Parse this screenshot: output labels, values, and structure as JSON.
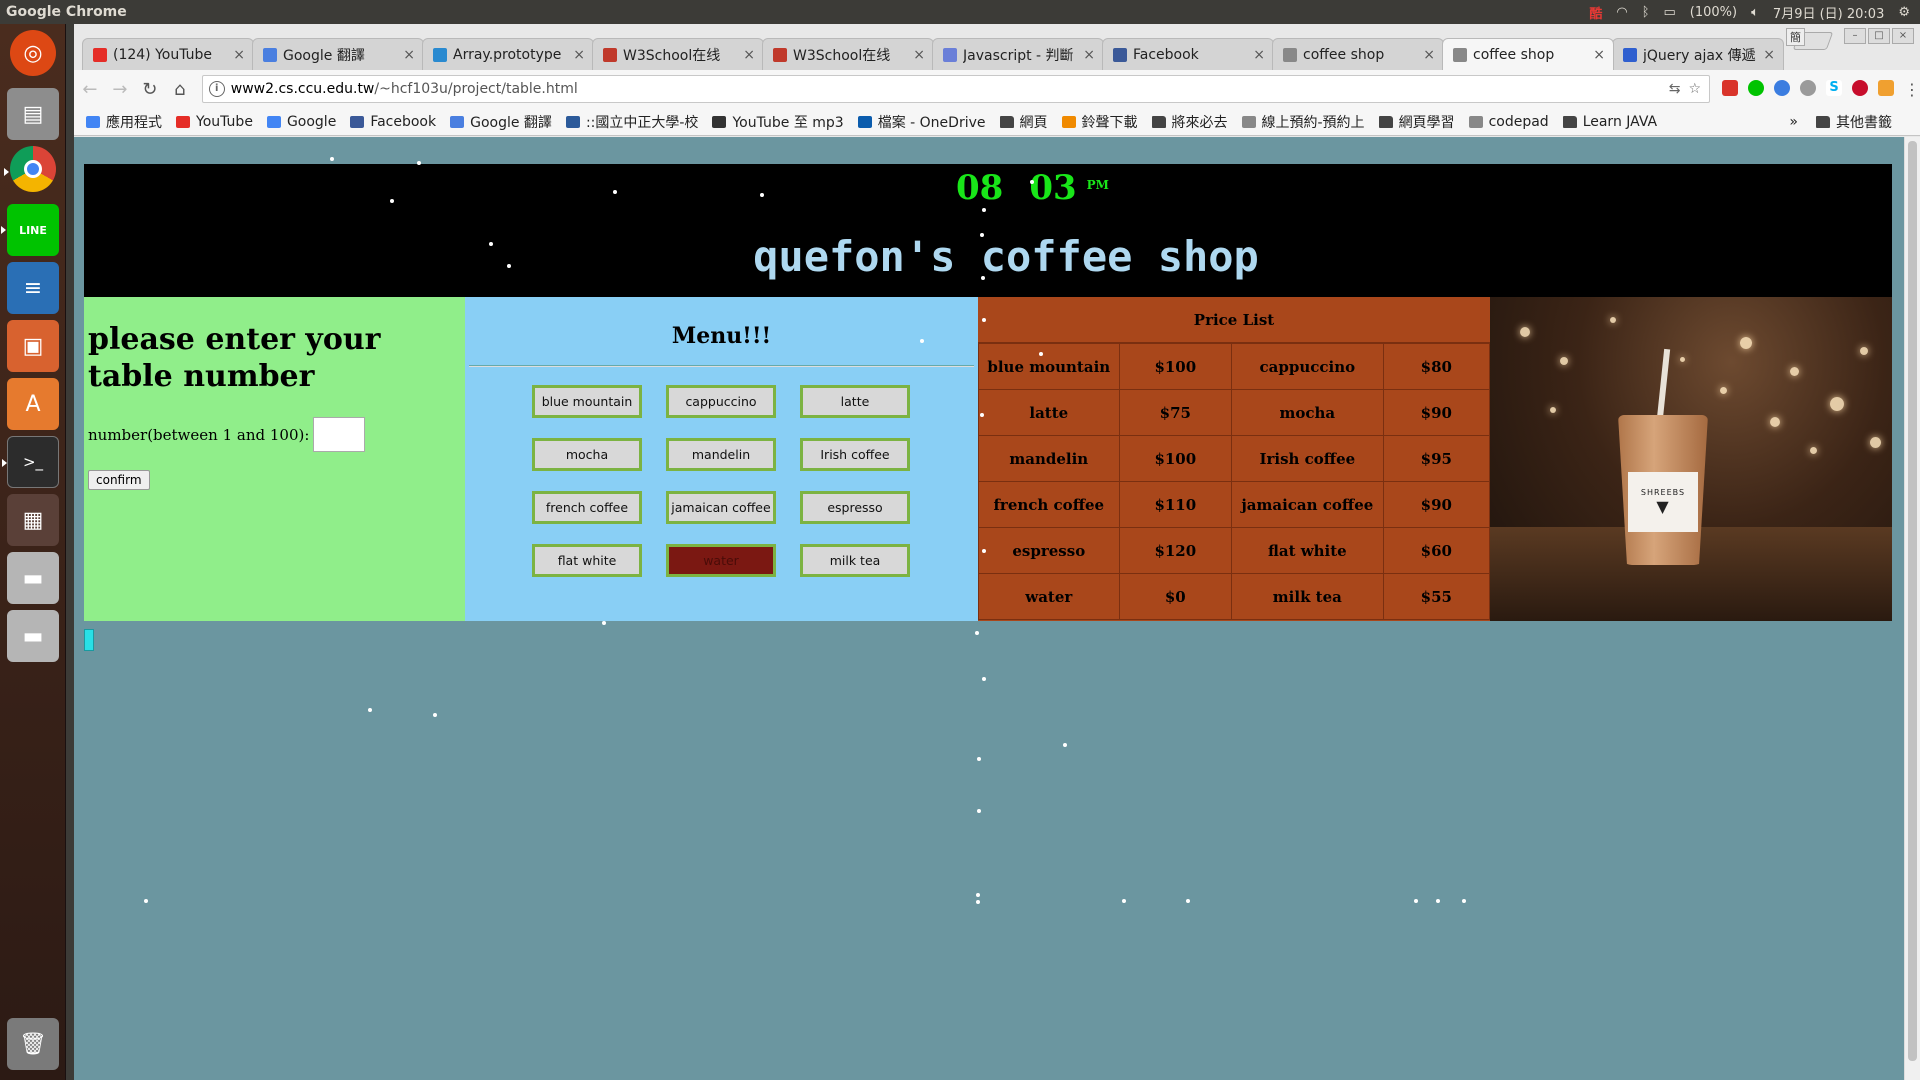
{
  "os": {
    "app_title": "Google Chrome",
    "battery": "(100%)",
    "datetime": "7月9日 (日) 20:03"
  },
  "browser": {
    "ime": "簡",
    "tabs": [
      {
        "label": "(124) YouTube",
        "color": "#e52d27"
      },
      {
        "label": "Google 翻譯",
        "color": "#4a7fe0"
      },
      {
        "label": "Array.prototype",
        "color": "#2a8ad0"
      },
      {
        "label": "W3School在线",
        "color": "#c0392b"
      },
      {
        "label": "W3School在线",
        "color": "#c0392b"
      },
      {
        "label": "Javascript - 判斷",
        "color": "#6a7fd8"
      },
      {
        "label": "Facebook",
        "color": "#3b5998"
      },
      {
        "label": "coffee shop",
        "color": "#888888"
      },
      {
        "label": "coffee shop",
        "color": "#888888"
      },
      {
        "label": "jQuery ajax 傳遞",
        "color": "#2f5fcf"
      }
    ],
    "active_tab_index": 8,
    "url_host": "www2.cs.ccu.edu.tw",
    "url_path": "/~hcf103u/project/table.html",
    "bookmarks": [
      {
        "label": "應用程式",
        "icon": "apps-grid-icon",
        "color": "#4285f4"
      },
      {
        "label": "YouTube",
        "icon": "youtube-icon",
        "color": "#e52d27"
      },
      {
        "label": "Google",
        "icon": "google-icon",
        "color": "#4285f4"
      },
      {
        "label": "Facebook",
        "icon": "facebook-icon",
        "color": "#3b5998"
      },
      {
        "label": "Google 翻譯",
        "icon": "translate-icon",
        "color": "#4a7fe0"
      },
      {
        "label": "::國立中正大學-校",
        "icon": "university-icon",
        "color": "#2c5a9a"
      },
      {
        "label": "YouTube 至 mp3",
        "icon": "converter-icon",
        "color": "#333333"
      },
      {
        "label": "檔案 - OneDrive",
        "icon": "onedrive-icon",
        "color": "#0b5cad"
      },
      {
        "label": "網頁",
        "icon": "folder-icon",
        "color": "#444444"
      },
      {
        "label": "鈴聲下載",
        "icon": "ringtone-icon",
        "color": "#f08a00"
      },
      {
        "label": "將來必去",
        "icon": "folder-icon",
        "color": "#444444"
      },
      {
        "label": "線上預約-預約上",
        "icon": "page-icon",
        "color": "#888888"
      },
      {
        "label": "網頁學習",
        "icon": "folder-icon",
        "color": "#444444"
      },
      {
        "label": "codepad",
        "icon": "page-icon",
        "color": "#888888"
      },
      {
        "label": "Learn JAVA",
        "icon": "folder-icon",
        "color": "#444444"
      }
    ],
    "overflow_label": "»",
    "other_bookmarks": "其他書籤"
  },
  "page": {
    "clock": {
      "hour": "08",
      "minute": "03",
      "ampm": "PM",
      "color": "#19e619"
    },
    "title": "quefon's coffee shop",
    "table_panel": {
      "heading": "please enter your table number",
      "number_label": "number(between 1 and 100):",
      "input_value": "",
      "confirm_label": "confirm"
    },
    "menu": {
      "heading": "Menu!!!",
      "items": [
        "blue mountain",
        "cappuccino",
        "latte",
        "mocha",
        "mandelin",
        "Irish coffee",
        "french coffee",
        "jamaican coffee",
        "espresso",
        "flat white",
        "water",
        "milk tea"
      ],
      "selected": "water"
    },
    "price_list": {
      "caption": "Price List",
      "rows": [
        [
          "blue mountain",
          "$100",
          "cappuccino",
          "$80"
        ],
        [
          "latte",
          "$75",
          "mocha",
          "$90"
        ],
        [
          "mandelin",
          "$100",
          "Irish coffee",
          "$95"
        ],
        [
          "french coffee",
          "$110",
          "jamaican coffee",
          "$90"
        ],
        [
          "espresso",
          "$120",
          "flat white",
          "$60"
        ],
        [
          "water",
          "$0",
          "milk tea",
          "$55"
        ]
      ]
    },
    "photo_brand": "SHREEBS"
  }
}
